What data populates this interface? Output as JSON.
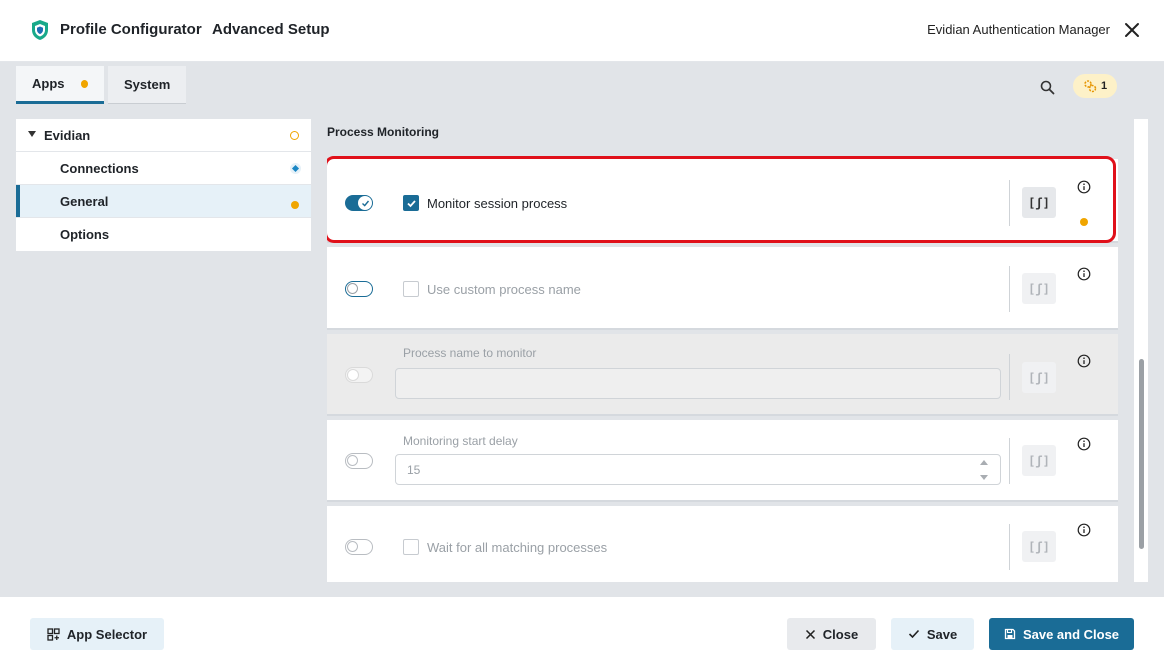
{
  "header": {
    "app_title": "Profile Configurator",
    "app_subtitle": "Advanced Setup",
    "product_name": "Evidian Authentication Manager",
    "icons": {
      "logo": "shield-icon",
      "close": "close-icon"
    }
  },
  "tabs": [
    {
      "label": "Apps",
      "active": true,
      "modified": true
    },
    {
      "label": "System",
      "active": false,
      "modified": false
    }
  ],
  "toolbar": {
    "search_icon": "search-icon",
    "notification_count": "1",
    "notification_icon": "gears-icon"
  },
  "tree": {
    "root": {
      "label": "Evidian",
      "expanded": true,
      "marker": "ring"
    },
    "items": [
      {
        "label": "Connections",
        "marker": "diamond",
        "selected": false
      },
      {
        "label": "General",
        "marker": "dot",
        "selected": true
      },
      {
        "label": "Options",
        "marker": "none",
        "selected": false
      }
    ]
  },
  "section": {
    "title": "Process Monitoring"
  },
  "settings": [
    {
      "label": "Monitor session process",
      "type": "checkbox",
      "checked": true,
      "toggle": "on",
      "script_label": "[ʃ]",
      "modified": true,
      "highlighted": true
    },
    {
      "label": "Use custom process name",
      "type": "checkbox",
      "checked": false,
      "toggle": "outline",
      "script_label": "[ʃ]",
      "modified": false
    },
    {
      "label": "Process name to monitor",
      "type": "text",
      "value": "",
      "toggle": "faint",
      "script_label": "[ʃ]",
      "disabled": true
    },
    {
      "label": "Monitoring start delay",
      "type": "number",
      "value": "15",
      "toggle": "off",
      "script_label": "[ʃ]"
    },
    {
      "label": "Wait for all matching processes",
      "type": "checkbox",
      "checked": false,
      "toggle": "off",
      "script_label": "[ʃ]"
    }
  ],
  "footer": {
    "app_selector": "App Selector",
    "close": "Close",
    "save": "Save",
    "save_and_close": "Save and Close"
  },
  "colors": {
    "accent": "#1a6c96",
    "modified_dot": "#f0a500",
    "highlight_border": "#e0101a",
    "background": "#e1e4e8"
  }
}
